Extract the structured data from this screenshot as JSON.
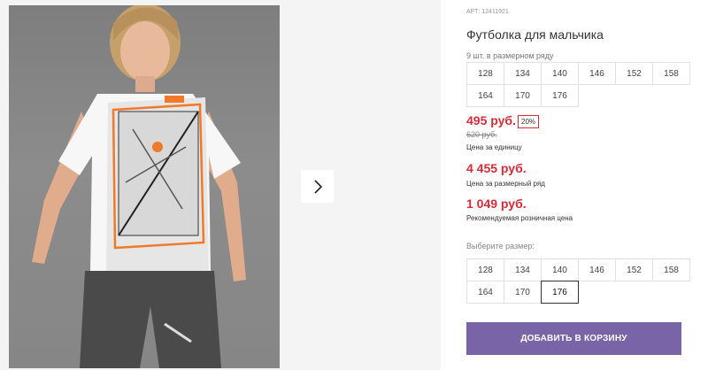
{
  "product": {
    "article": "АРТ: 12411921",
    "title": "Футболка для мальчика",
    "row_note": "9 шт. в размерном ряду",
    "row_sizes": [
      "128",
      "134",
      "140",
      "146",
      "152",
      "158",
      "164",
      "170",
      "176"
    ]
  },
  "pricing": {
    "price": "495 руб.",
    "discount": "20%",
    "old_price": "620 руб.",
    "unit_note": "Цена за единицу",
    "row_price": "4 455 руб.",
    "row_note": "Цена за размерный ряд",
    "retail_price": "1 049 руб.",
    "retail_note": "Рекомендуемая розничная цена"
  },
  "size_picker": {
    "label": "Выберите размер:",
    "sizes": [
      "128",
      "134",
      "140",
      "146",
      "152",
      "158",
      "164",
      "170",
      "176"
    ],
    "selected": "176"
  },
  "actions": {
    "add_to_cart": "ДОБАВИТЬ В КОРЗИНУ"
  },
  "icons": {
    "next": "chevron-right-icon"
  },
  "colors": {
    "accent": "#7a64a8",
    "price": "#d62c3a"
  }
}
